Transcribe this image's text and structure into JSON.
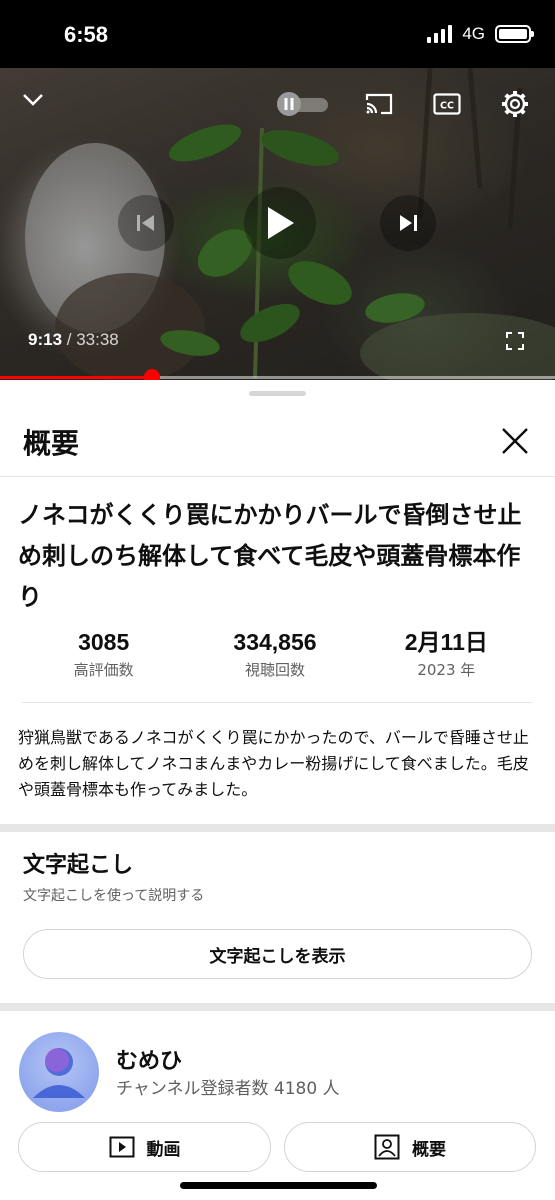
{
  "status_bar": {
    "time": "6:58",
    "network": "4G"
  },
  "player": {
    "current_time": "9:13",
    "separator": " / ",
    "duration": "33:38",
    "progress": 0.273,
    "icons": [
      "chevron-down-icon",
      "pause-autoplay-toggle-icon",
      "cast-icon",
      "captions-icon",
      "settings-gear-icon",
      "previous-icon",
      "play-icon",
      "next-icon",
      "fullscreen-icon"
    ]
  },
  "sheet": {
    "title": "概要",
    "video_title": "ノネコがくくり罠にかかりバールで昏倒させ止め刺しのち解体して食べて毛皮や頭蓋骨標本作り",
    "stats": [
      {
        "value": "3085",
        "label": "高評価数"
      },
      {
        "value": "334,856",
        "label": "視聴回数"
      },
      {
        "value": "2月11日",
        "label": "2023 年"
      }
    ],
    "description": "狩猟鳥獣であるノネコがくくり罠にかかったので、バールで昏睡させ止めを刺し解体してノネコまんまやカレー粉揚げにして食べました。毛皮や頭蓋骨標本も作ってみました。",
    "transcript": {
      "title": "文字起こし",
      "subtitle": "文字起こしを使って説明する",
      "button": "文字起こしを表示"
    },
    "channel": {
      "name": "むめひ",
      "subscribers": "チャンネル登録者数 4180 人",
      "videos_button": "動画",
      "about_button": "概要"
    }
  },
  "colors": {
    "accent": "#ff0000",
    "text": "#0f0f0f",
    "secondary": "#606060"
  }
}
